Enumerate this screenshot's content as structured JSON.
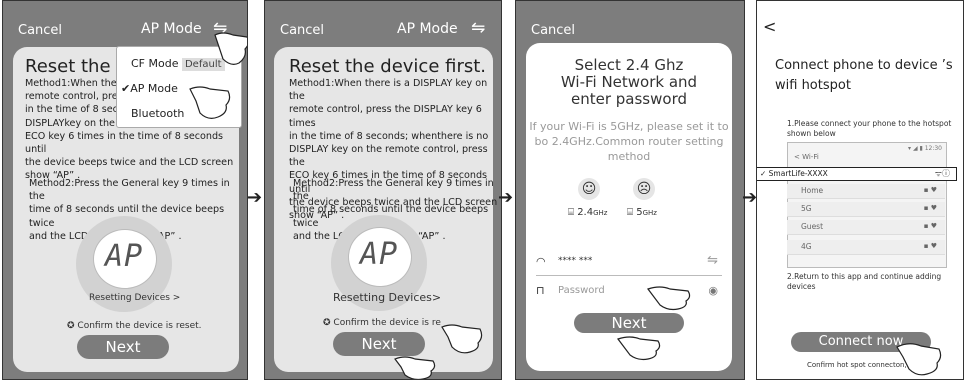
{
  "screen1": {
    "cancel": "Cancel",
    "mode": "AP Mode",
    "title": "Reset the de",
    "method1_lines": [
      "Method1:When there",
      "remote control, press",
      "in the time of 8 secon",
      "DISPLAYkey on the re",
      "ECO key 6 times in the time of 8 seconds until",
      "the device beeps twice and the LCD screen",
      "show “AP” ."
    ],
    "method2_lines": [
      "Method2:Press the General key 9 times in the",
      "time of 8 seconds until the device beeps twice",
      "and the LCD screen show “AP” ."
    ],
    "lcd": "AP",
    "resetting": "Resetting Devices >",
    "confirm": "Confirm the device is reset.",
    "next": "Next",
    "menu": [
      {
        "label": "CF Mode",
        "badge": "Default"
      },
      {
        "label": "✔AP Mode"
      },
      {
        "label": "Bluetooth"
      }
    ]
  },
  "screen2": {
    "cancel": "Cancel",
    "mode": "AP Mode",
    "title": "Reset the device first.",
    "method1_lines": [
      "Method1:When there is a DISPLAY key on the",
      "remote control, press the DISPLAY key 6 times",
      "in the time of 8 seconds; whenthere is no",
      "DISPLAY key on the remote control, press the",
      "ECO key 6 times in the time of 8 seconds until",
      "the device beeps twice and the LCD screen",
      "show “AP” ."
    ],
    "method2_lines": [
      "Method2:Press the General key 9 times in the",
      "time of 8 seconds until the device beeps twice",
      "and the LCD screen show “AP” ."
    ],
    "lcd": "AP",
    "resetting": "Resetting Devices>",
    "confirm": "Confirm the device is re",
    "next": "Next"
  },
  "screen3": {
    "cancel": "Cancel",
    "title_lines": [
      "Select 2.4 Ghz",
      "Wi-Fi Network and",
      "enter password"
    ],
    "hint_lines": [
      "If your Wi-Fi is 5GHz, please set it to",
      "bo 2.4GHz.Common router setting",
      "method"
    ],
    "band1": "2.4",
    "band1_unit": "GHz",
    "band2": "5",
    "band2_unit": "GHz",
    "ssid": "**** ***",
    "password_placeholder": "Password",
    "next": "Next"
  },
  "screen4": {
    "back": "<",
    "title_lines": [
      "Connect phone to device ’s",
      "wifi hotspot"
    ],
    "step1_lines": [
      "1.Please connect your phone to the hotspot",
      "shown below"
    ],
    "phone_time": "12:30",
    "wifi_header": "< Wi-Fi",
    "networks": [
      "✓ SmartLife-XXXX",
      "Home",
      "5G",
      "Guest",
      "4G"
    ],
    "step2_lines": [
      "2.Return to this app and continue adding",
      "devices"
    ],
    "connect": "Connect now",
    "confirm": "Confirm hot spot connecton,n"
  }
}
